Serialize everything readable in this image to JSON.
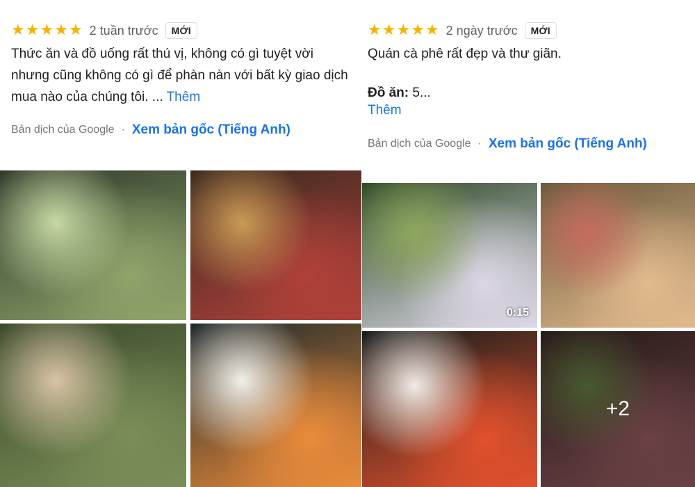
{
  "review_left": {
    "stars": "★★★★★",
    "time_ago": "2 tuần trước",
    "badge": "MỚI",
    "text": "Thức ăn và đồ uống rất thú vị, không có gì tuyệt vời nhưng cũng không có gì để phàn nàn với bất kỳ giao dịch mua nào của chúng tôi. ...",
    "more_label": "Thêm",
    "translated_by": "Bản dịch của Google",
    "separator": "·",
    "view_original": "Xem bản gốc (Tiếng Anh)"
  },
  "review_right": {
    "stars": "★★★★★",
    "time_ago": "2 ngày trước",
    "badge": "MỚI",
    "text": "Quán cà phê rất đẹp và thư giãn.",
    "food_label": "Đồ ăn:",
    "food_value": "5...",
    "more_label": "Thêm",
    "translated_by": "Bản dịch của Google",
    "separator": "·",
    "view_original": "Xem bản gốc (Tiếng Anh)"
  },
  "photos_left": [
    {
      "name": "garden-mist-photo",
      "colors": [
        "#2f3a2c",
        "#8fa36a",
        "#c7d9a4"
      ]
    },
    {
      "name": "tree-hall-photo",
      "colors": [
        "#3b2a20",
        "#b0413a",
        "#c99b54"
      ]
    },
    {
      "name": "iced-coffee-photo",
      "colors": [
        "#3c4a2b",
        "#7b8e58",
        "#d8c3a5"
      ]
    },
    {
      "name": "koi-pond-photo-1",
      "colors": [
        "#1f2a2c",
        "#e98b3b",
        "#f0f0ea"
      ]
    }
  ],
  "photos_right": [
    {
      "name": "flower-wall-video",
      "colors": [
        "#2f4a27",
        "#dcd7e6",
        "#8fa85c"
      ],
      "duration": "0:15"
    },
    {
      "name": "drink-palm-photo",
      "colors": [
        "#6b5a3e",
        "#e1b98c",
        "#c66b5e"
      ]
    },
    {
      "name": "koi-pond-photo-2",
      "colors": [
        "#161d1c",
        "#e2512d",
        "#f2ece6"
      ]
    },
    {
      "name": "terrace-garden-photo",
      "colors": [
        "#3d2a27",
        "#a3646a",
        "#6e8a4a"
      ],
      "more_count": "+2"
    }
  ]
}
